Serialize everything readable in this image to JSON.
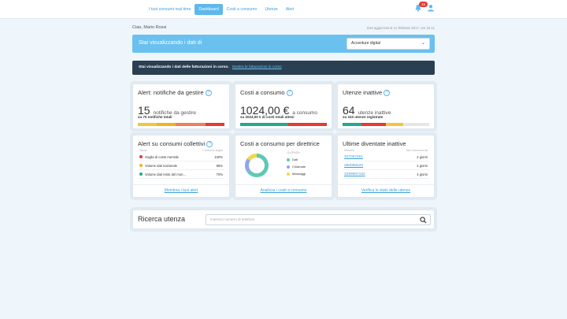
{
  "header": {
    "nav": [
      "I tuoi consumi real time",
      "Dashboard",
      "Costi a consumo",
      "Utenze",
      "Alert"
    ],
    "active_nav": "Dashboard",
    "notification_count": "15",
    "colors": {
      "accent": "#5eb8ec",
      "badge": "#e53935"
    }
  },
  "greeting": "Ciao, Mario Rossi",
  "updated": "Dati aggiornati al 14 febbraio 2017, ore 22.11",
  "selector": {
    "label": "Stai visualizzando i dati di",
    "value": "Accenture digital"
  },
  "banner": {
    "text": "Stai visualizzando i dati delle fatturazioni in corso.",
    "link": "Mostra le fatturazioni in corso"
  },
  "card_alert": {
    "title": "Alert: notifiche da gestire",
    "value": "15",
    "unit": "notifiche da gestire",
    "sub": "su 70 notifiche totali",
    "bar": [
      {
        "color": "#f5c542",
        "w": 22
      },
      {
        "color": "#f5b021",
        "w": 22
      },
      {
        "color": "#f07f5a",
        "w": 34
      },
      {
        "color": "#e53935",
        "w": 22
      }
    ],
    "link": "Monitora i tuoi alert"
  },
  "card_costi": {
    "title": "Costi a consumo",
    "value": "1024,00 €",
    "unit": "a consumo",
    "sub": "su 2024,00 € di costi totali attesi",
    "bar": [
      {
        "color": "#24a88b",
        "w": 55
      },
      {
        "color": "#e53935",
        "w": 45
      }
    ],
    "link": "Analizza i costi a consumo"
  },
  "card_utenze": {
    "title": "Utenze inattive",
    "value": "64",
    "unit": "utenze inattive",
    "sub": "su 243 utenze registrate",
    "bar": [
      {
        "color": "#24a88b",
        "w": 22
      },
      {
        "color": "#e53935",
        "w": 28
      },
      {
        "color": "#f5c542",
        "w": 20
      },
      {
        "color": "#e6e6e6",
        "w": 30
      }
    ],
    "link": "Verifica lo stato delle utenze"
  },
  "card_collettivi": {
    "title": "Alert su consumi collettivi",
    "col_name": "Nome",
    "col_threshold": "Consumo soglia",
    "rows": [
      {
        "name": "Soglia di costo mensile",
        "value": "100%",
        "color": "#e53935"
      },
      {
        "name": "Volume dati nazionale",
        "value": "85%",
        "color": "#f5b021"
      },
      {
        "name": "Volume dati resto del mon...",
        "value": "70%",
        "color": "#24a88b"
      }
    ]
  },
  "card_direttrice": {
    "title": "Costi a consumo per direttrice",
    "legend_title": "LEGENDA",
    "legend": [
      {
        "name": "Dati",
        "color": "#5ec9b5"
      },
      {
        "name": "Chiamate",
        "color": "#8fa6e8"
      },
      {
        "name": "Messaggi",
        "color": "#f5d547"
      }
    ],
    "chart_data": {
      "type": "pie",
      "labels": [
        "Dati",
        "Chiamate",
        "Messaggi"
      ],
      "values": [
        65,
        20,
        15
      ]
    }
  },
  "card_ultime": {
    "title": "Ultime diventate inattive",
    "col_number": "Numero",
    "col_days": "Non consuma da",
    "rows": [
      {
        "number": "347097251",
        "days": "2 giorni"
      },
      {
        "number": "280098220",
        "days": "2 giorni"
      },
      {
        "number": "3299987162",
        "days": "4 giorni"
      }
    ]
  },
  "search": {
    "title": "Ricerca utenza",
    "placeholder": "Inserisci numero di telefono"
  }
}
